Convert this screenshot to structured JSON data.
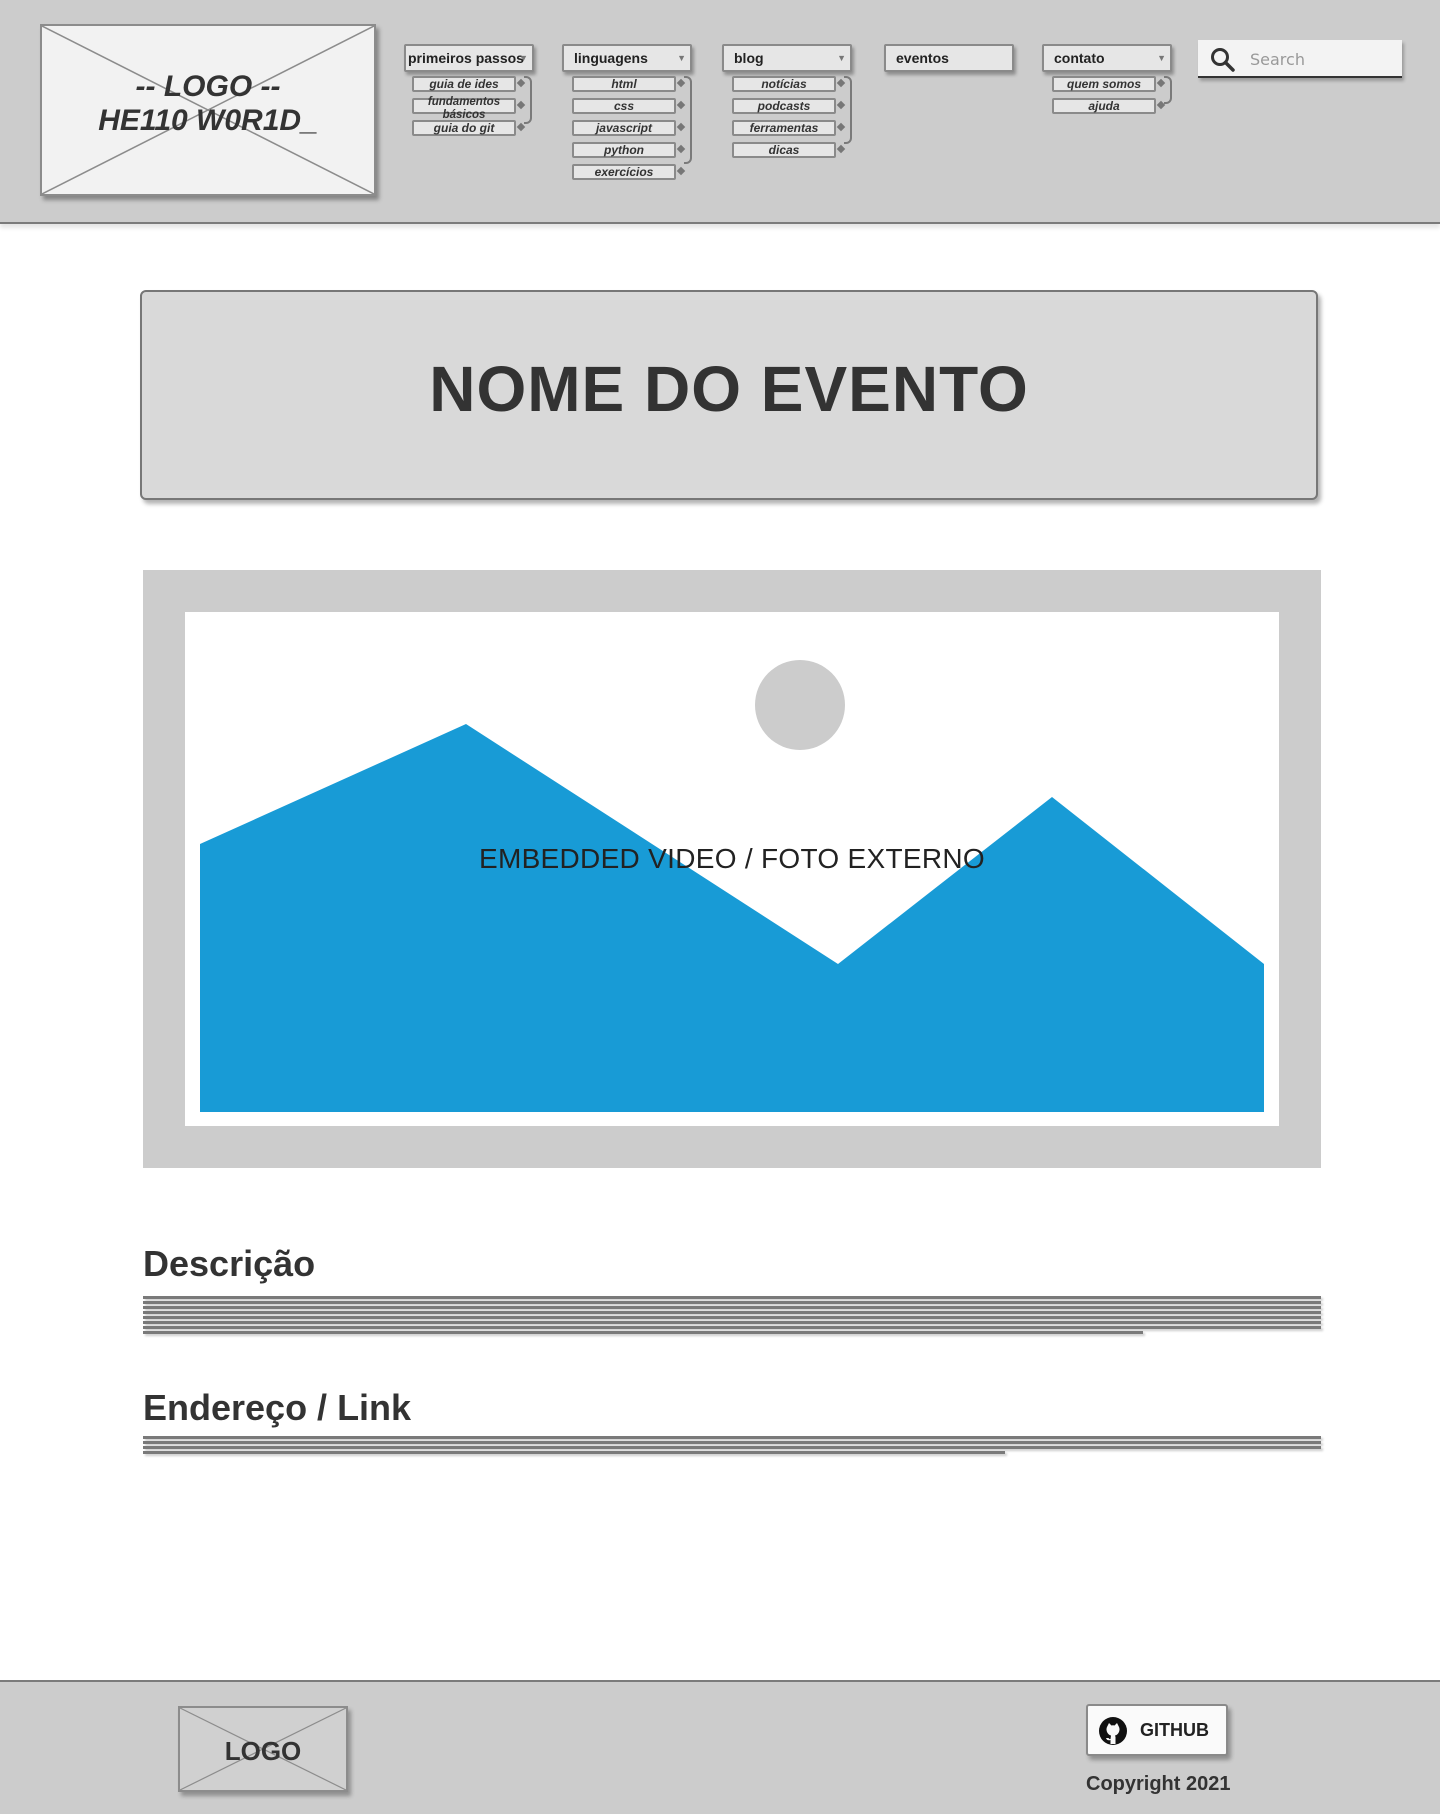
{
  "header": {
    "logo": {
      "line1": "-- LOGO --",
      "line2": "HE110 W0R1D_"
    },
    "nav": [
      {
        "label": "primeiros passos",
        "items": [
          "guia de ides",
          "fundamentos básicos",
          "guia do git"
        ]
      },
      {
        "label": "linguagens",
        "items": [
          "html",
          "css",
          "javascript",
          "python",
          "exercícios"
        ]
      },
      {
        "label": "blog",
        "items": [
          "notícias",
          "podcasts",
          "ferramentas",
          "dicas"
        ]
      },
      {
        "label": "eventos",
        "items": []
      },
      {
        "label": "contato",
        "items": [
          "quem somos",
          "ajuda"
        ]
      }
    ],
    "search": {
      "placeholder": "Search"
    }
  },
  "main": {
    "event_title": "NOME DO EVENTO",
    "media_caption": "EMBEDDED VIDEO / FOTO EXTERNO",
    "description_heading": "Descrição",
    "address_heading": "Endereço / Link"
  },
  "footer": {
    "logo_label": "LOGO",
    "github_label": "GITHUB",
    "copyright": "Copyright 2021"
  },
  "colors": {
    "header_bg": "#cccccc",
    "accent_blue": "#189bd6",
    "text": "#333333"
  }
}
